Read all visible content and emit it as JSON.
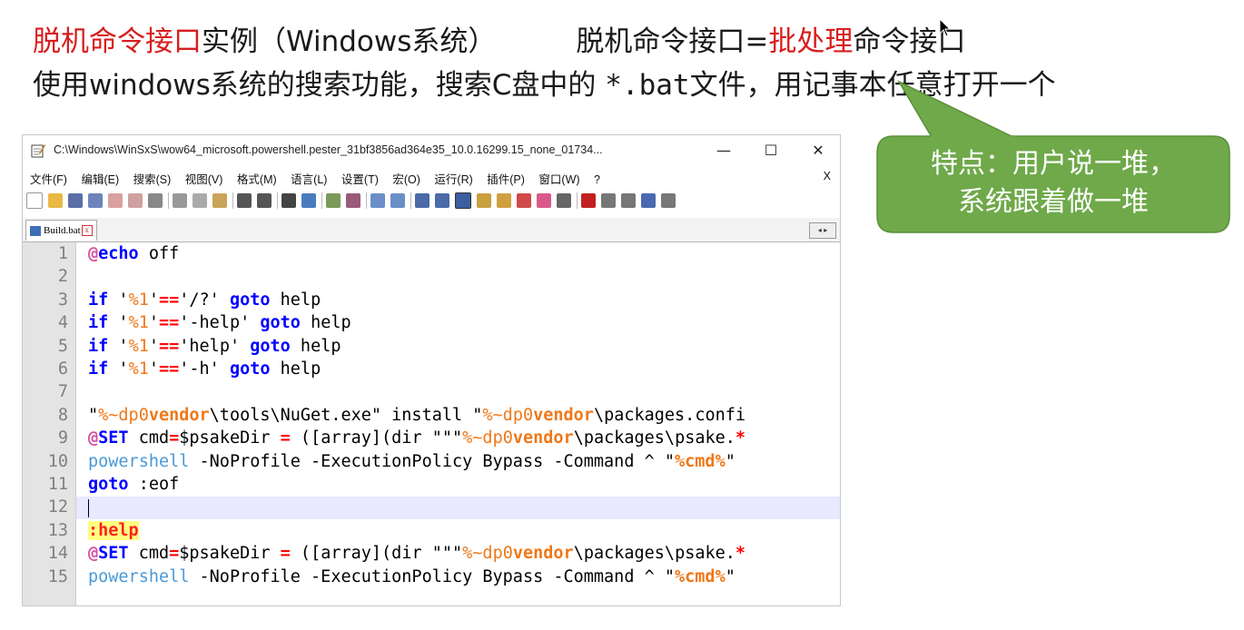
{
  "slide": {
    "title_part1_red": "脱机命令接口",
    "title_part2": "实例（Windows系统）",
    "title_part3": "脱机命令接口=",
    "title_part4_red": "批处理",
    "title_part5": "命令接口",
    "subtitle_part1": "使用windows系统的搜索功能，搜索C盘中的 ",
    "subtitle_code": "*.bat",
    "subtitle_part2": "文件，用记事本任意打开一个"
  },
  "callout": {
    "line1": "特点：用户说一堆，",
    "line2": "系统跟着做一堆",
    "color": "#6fa94a"
  },
  "window": {
    "title": "C:\\Windows\\WinSxS\\wow64_microsoft.powershell.pester_31bf3856ad364e35_10.0.16299.15_none_01734...",
    "minimize": "—",
    "maximize": "☐",
    "close": "✕",
    "menu": [
      "文件(F)",
      "编辑(E)",
      "搜索(S)",
      "视图(V)",
      "格式(M)",
      "语言(L)",
      "设置(T)",
      "宏(O)",
      "运行(R)",
      "插件(P)",
      "窗口(W)",
      "?"
    ],
    "menu_close": "X",
    "tab_label": "Build.bat",
    "tab_close": "x",
    "tab_arrows": "◂ ▸"
  },
  "editor": {
    "line_numbers": [
      "1",
      "2",
      "3",
      "4",
      "5",
      "6",
      "7",
      "8",
      "9",
      "10",
      "11",
      "12",
      "13",
      "14",
      "15"
    ],
    "current_line": 12
  },
  "code": {
    "l1_at": "@",
    "l1_kw": "echo",
    "l1_rest": " off",
    "if": "if",
    "q": "'",
    "arg": "%1",
    "eq": "==",
    "goto": "goto",
    "help": " help",
    "l3_val": "'/?'",
    "l4_val": "'-help'",
    "l5_val": "'help'",
    "l6_val": "'-h'",
    "l8_q": "\"",
    "dp0": "%~dp0",
    "vendor": "vendor",
    "l8_mid": "\\tools\\NuGet.exe\" install \"",
    "l8_end": "\\packages.confi",
    "set_at": "@",
    "set_kw": "SET",
    "set_a": " cmd",
    "set_eq": "=",
    "set_b": "$psakeDir ",
    "set_eq2": "=",
    "set_c": " ([array](dir \"\"\"",
    "set_d": "\\packages\\psake.",
    "star": "*",
    "ps": "powershell",
    "ps_rest": " -NoProfile -ExecutionPolicy Bypass -Command ^ \"",
    "cmdvar": "%cmd%",
    "ps_end": "\"",
    "eof": " :eof",
    "label_help": ":help"
  }
}
